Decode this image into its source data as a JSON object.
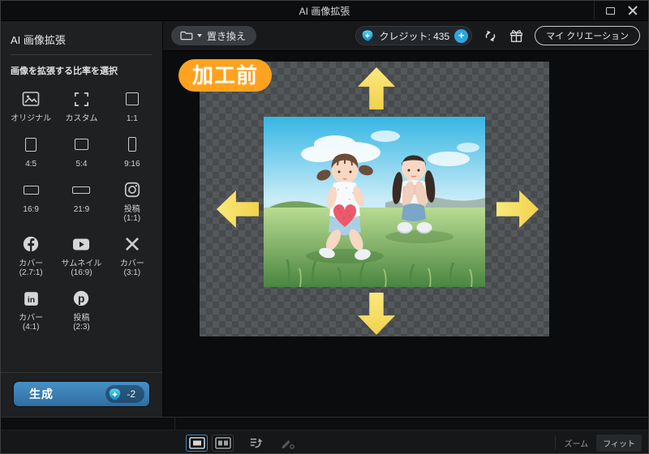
{
  "window": {
    "title": "AI 画像拡張"
  },
  "sidebar": {
    "title": "AI 画像拡張",
    "subtitle": "画像を拡張する比率を選択",
    "ratio_options": [
      {
        "icon": "original",
        "label": "オリジナル"
      },
      {
        "icon": "custom",
        "label": "カスタム"
      },
      {
        "icon": "ratio-1-1",
        "label": "1:1"
      },
      {
        "icon": "ratio-4-5",
        "label": "4:5"
      },
      {
        "icon": "ratio-5-4",
        "label": "5:4"
      },
      {
        "icon": "ratio-9-16",
        "label": "9:16"
      },
      {
        "icon": "ratio-16-9",
        "label": "16:9"
      },
      {
        "icon": "ratio-21-9",
        "label": "21:9"
      },
      {
        "icon": "instagram",
        "label": "投稿",
        "sub": "(1:1)"
      },
      {
        "icon": "facebook",
        "label": "カバー",
        "sub": "(2.7:1)"
      },
      {
        "icon": "youtube",
        "label": "サムネイル",
        "sub": "(16:9)"
      },
      {
        "icon": "x",
        "label": "カバー",
        "sub": "(3:1)"
      },
      {
        "icon": "linkedin",
        "label": "カバー",
        "sub": "(4:1)"
      },
      {
        "icon": "pinterest",
        "label": "投稿",
        "sub": "(2:3)"
      }
    ],
    "generate": {
      "label": "生成",
      "cost": "-2"
    }
  },
  "toolbar": {
    "replace_label": "置き換え",
    "credits_label": "クレジット:",
    "credits_value": "435",
    "add_credits_label": "+",
    "my_creations_label": "マイ クリエーション"
  },
  "canvas": {
    "badge": "加工前"
  },
  "statusbar": {
    "zoom_label": "ズーム",
    "fit_label": "フィット"
  },
  "colors": {
    "accent_blue": "#2fa6e0",
    "generate_blue": "#3a7fb4",
    "badge_orange": "#ffa220",
    "arrow_yellow": "#f6dd5f"
  },
  "icons": [
    "folder-icon",
    "credit-shield-icon",
    "plus-icon",
    "refresh-icon",
    "gift-icon",
    "maximize-icon",
    "close-icon",
    "single-view-icon",
    "compare-view-icon",
    "export-list-icon",
    "pen-icon"
  ]
}
